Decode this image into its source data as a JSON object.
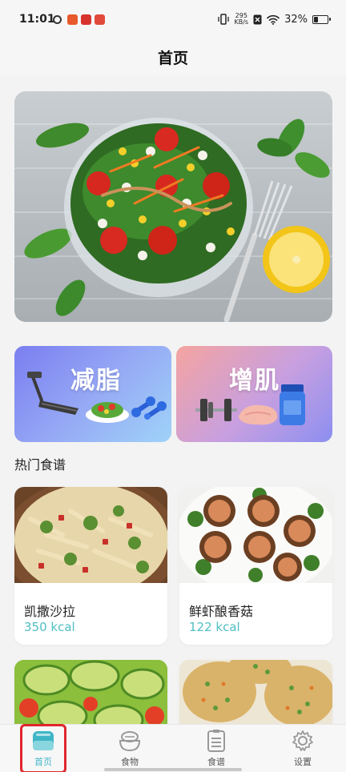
{
  "status_bar": {
    "time": "11:01",
    "net_speed_value": "295",
    "net_speed_unit": "KB/s",
    "battery": "32%",
    "battery_level": 0.32
  },
  "header": {
    "title": "首页"
  },
  "categories": [
    {
      "label": "减脂"
    },
    {
      "label": "增肌"
    }
  ],
  "hot_recipes": {
    "title": "热门食谱",
    "items": [
      {
        "name": "凯撒沙拉",
        "kcal": "350 kcal"
      },
      {
        "name": "鲜虾酿香菇",
        "kcal": "122 kcal"
      }
    ]
  },
  "tab_bar": {
    "items": [
      {
        "label": "首页",
        "icon": "home-icon",
        "active": true
      },
      {
        "label": "食物",
        "icon": "food-bowl-icon",
        "active": false
      },
      {
        "label": "食谱",
        "icon": "recipe-list-icon",
        "active": false
      },
      {
        "label": "设置",
        "icon": "gear-icon",
        "active": false
      }
    ]
  },
  "colors": {
    "accent": "#3fb6c6",
    "kcal": "#4fbfc3",
    "highlight": "#e0262c"
  }
}
